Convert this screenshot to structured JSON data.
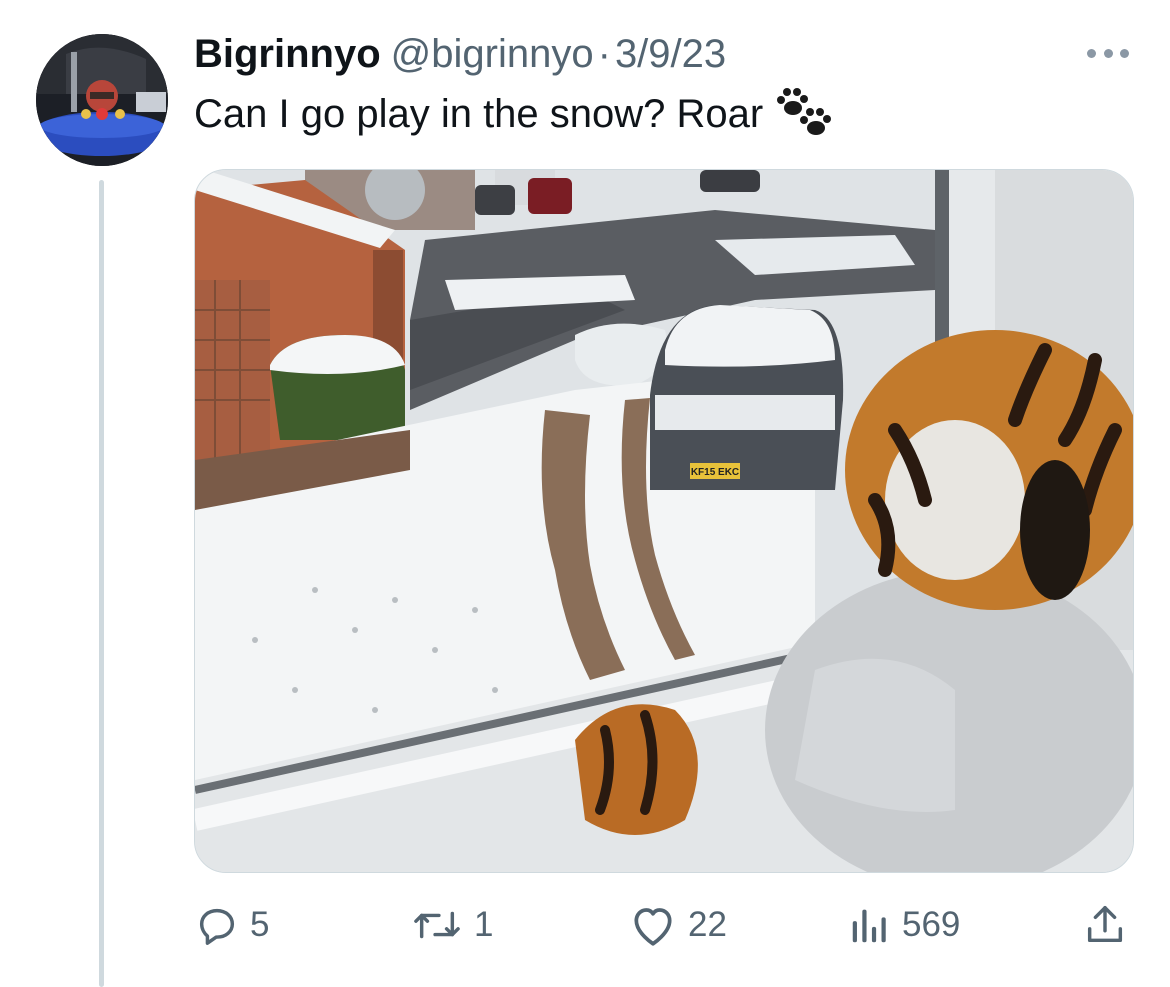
{
  "tweet": {
    "author_name": "Bigrinnyo",
    "handle": "@bigrinnyo",
    "separator": "·",
    "date": "3/9/23",
    "text": "Can I go play in the snow? Roar",
    "text_emoji_icon": "paw-prints-icon",
    "avatar_icon": "avatar-racing-driver",
    "more_icon": "more-dots-icon"
  },
  "media": {
    "description_icon": "photo-snow-street-tiger-plush",
    "license_plate": "KF15 EKC"
  },
  "actions": {
    "reply": {
      "icon": "reply-icon",
      "count": "5"
    },
    "retweet": {
      "icon": "retweet-icon",
      "count": "1"
    },
    "like": {
      "icon": "heart-icon",
      "count": "22"
    },
    "views": {
      "icon": "views-bar-chart-icon",
      "count": "569"
    },
    "share": {
      "icon": "share-icon"
    }
  },
  "colors": {
    "text_primary": "#0f1419",
    "text_secondary": "#536471",
    "thread_line": "#cfd9de"
  }
}
